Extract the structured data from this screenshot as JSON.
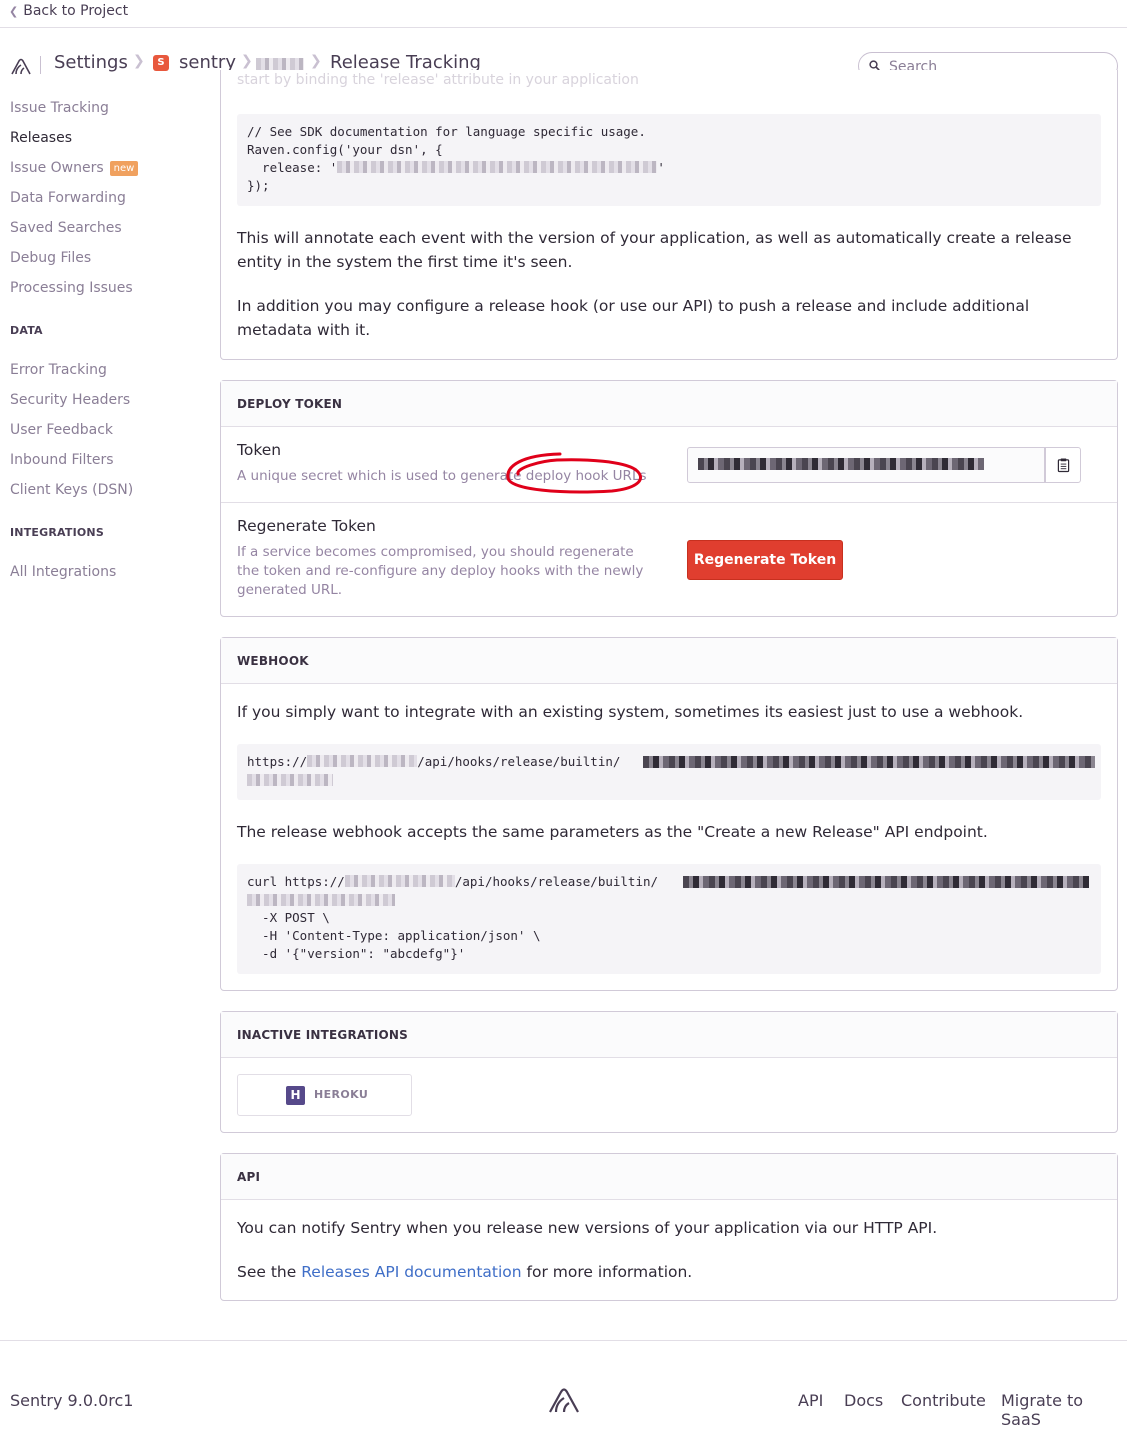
{
  "back_link": "Back to Project",
  "breadcrumb": {
    "settings": "Settings",
    "project_initial": "S",
    "project": "sentry",
    "page": "Release Tracking"
  },
  "search": {
    "placeholder": "Search"
  },
  "sidebar": {
    "items_top": [
      {
        "label": "Issue Tracking"
      },
      {
        "label": "Releases",
        "active": true
      },
      {
        "label": "Issue Owners",
        "badge": "new"
      },
      {
        "label": "Data Forwarding"
      },
      {
        "label": "Saved Searches"
      },
      {
        "label": "Debug Files"
      },
      {
        "label": "Processing Issues"
      }
    ],
    "data_heading": "DATA",
    "items_data": [
      {
        "label": "Error Tracking"
      },
      {
        "label": "Security Headers"
      },
      {
        "label": "User Feedback"
      },
      {
        "label": "Inbound Filters"
      },
      {
        "label": "Client Keys (DSN)"
      }
    ],
    "integrations_heading": "INTEGRATIONS",
    "items_integrations": [
      {
        "label": "All Integrations"
      }
    ]
  },
  "config_panel": {
    "cut_text": "start by binding the 'release' attribute in your application",
    "code_line1": "// See SDK documentation for language specific usage.",
    "code_line2": "Raven.config('your dsn', {",
    "code_line3_prefix": "  release: '",
    "code_line3_suffix": "'",
    "code_line4": "});",
    "para1": "This will annotate each event with the version of your application, as well as automatically create a release entity in the system the first time it's seen.",
    "para2": "In addition you may configure a release hook (or use our API) to push a release and include additional metadata with it."
  },
  "deploy_token": {
    "heading": "DEPLOY TOKEN",
    "token_label": "Token",
    "token_help": "A unique secret which is used to generate deploy hook URLs",
    "regen_label": "Regenerate Token",
    "regen_help": "If a service becomes compromised, you should regenerate the token and re-configure any deploy hooks with the newly generated URL.",
    "regen_button": "Regenerate Token"
  },
  "webhook": {
    "heading": "WEBHOOK",
    "intro": "If you simply want to integrate with an existing system, sometimes its easiest just to use a webhook.",
    "url_prefix": "https://",
    "url_path": "/api/hooks/release/builtin/",
    "note": "The release webhook accepts the same parameters as the \"Create a new Release\" API endpoint.",
    "curl_prefix": "curl https://",
    "curl_path": "/api/hooks/release/builtin/",
    "curl_line2": "  -X POST \\",
    "curl_line3": "  -H 'Content-Type: application/json' \\",
    "curl_line4": "  -d '{\"version\": \"abcdefg\"}'"
  },
  "inactive_integrations": {
    "heading": "INACTIVE INTEGRATIONS",
    "heroku_label": "HEROKU",
    "heroku_icon": "heroku-icon"
  },
  "api": {
    "heading": "API",
    "para1": "You can notify Sentry when you release new versions of your application via our HTTP API.",
    "para2_prefix": "See the ",
    "para2_link": "Releases API documentation",
    "para2_suffix": " for more information."
  },
  "footer": {
    "version": "Sentry 9.0.0rc1",
    "links": [
      "API",
      "Docs",
      "Contribute",
      "Migrate to SaaS"
    ]
  },
  "colors": {
    "accent_link": "#3f6ec7",
    "danger_button": "#e03e2f",
    "project_badge": "#e8583d",
    "new_badge": "#f0a15f",
    "annotation": "#e0001a"
  }
}
